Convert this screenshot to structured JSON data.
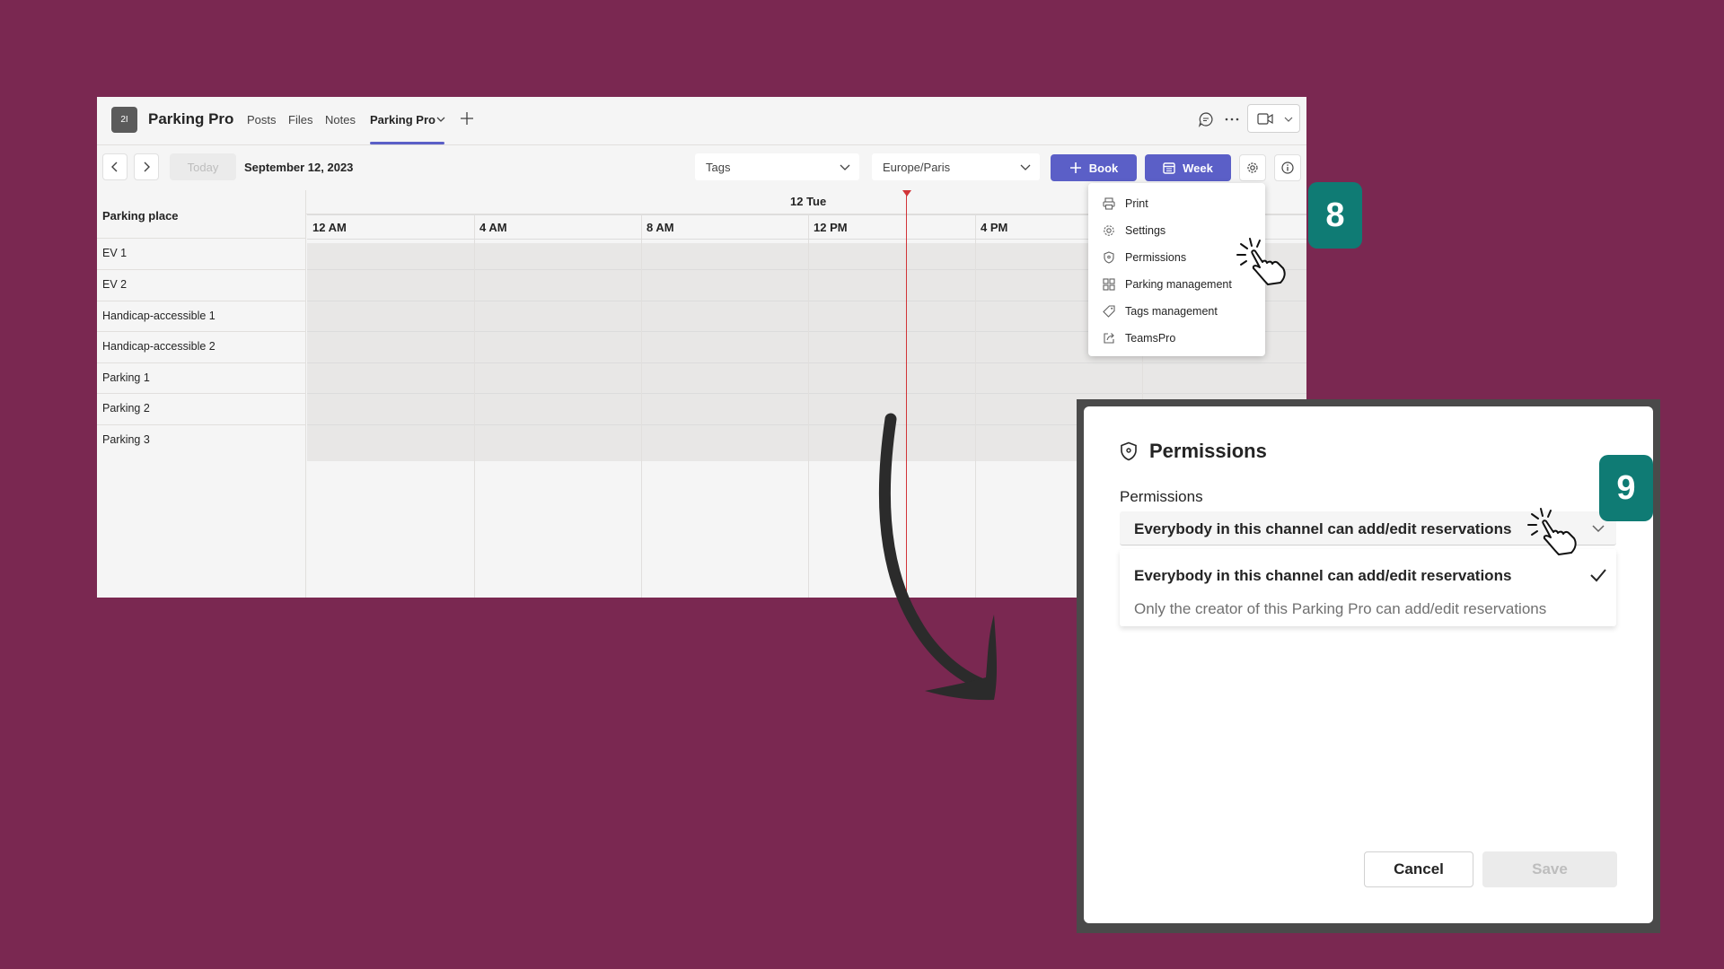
{
  "teams": {
    "team_initials": "2I",
    "app_title": "Parking Pro",
    "tabs": [
      "Posts",
      "Files",
      "Notes",
      "Parking Pro"
    ],
    "toolbar": {
      "today_label": "Today",
      "date_label": "September 12, 2023",
      "tags_placeholder": "Tags",
      "timezone_value": "Europe/Paris",
      "book_label": "Book",
      "week_label": "Week"
    },
    "calendar": {
      "left_header": "Parking place",
      "day_label": "12 Tue",
      "hours": [
        "12 AM",
        "4 AM",
        "8 AM",
        "12 PM",
        "4 PM"
      ],
      "rows": [
        "EV 1",
        "EV 2",
        "Handicap-accessible 1",
        "Handicap-accessible 2",
        "Parking 1",
        "Parking 2",
        "Parking 3"
      ]
    },
    "menu": {
      "items": [
        {
          "label": "Print",
          "icon": "printer-icon"
        },
        {
          "label": "Settings",
          "icon": "gear-icon"
        },
        {
          "label": "Permissions",
          "icon": "shield-icon"
        },
        {
          "label": "Parking management",
          "icon": "grid-icon"
        },
        {
          "label": "Tags management",
          "icon": "tag-icon"
        },
        {
          "label": "TeamsPro",
          "icon": "share-icon"
        }
      ]
    }
  },
  "badges": {
    "step8": "8",
    "step9": "9"
  },
  "dialog": {
    "title": "Permissions",
    "field_label": "Permissions",
    "selected_value": "Everybody in this channel can add/edit reservations",
    "options": [
      "Everybody in this channel can add/edit reservations",
      "Only the creator of this Parking Pro can add/edit reservations"
    ],
    "cancel_label": "Cancel",
    "save_label": "Save"
  },
  "colors": {
    "background": "#7a2851",
    "accent": "#5b5fc7",
    "badge": "#0f7b74",
    "now_line": "#d13438"
  }
}
